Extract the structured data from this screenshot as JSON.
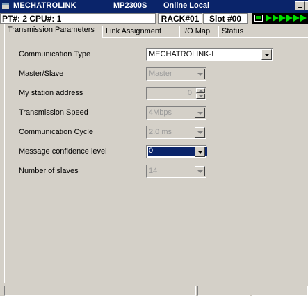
{
  "window": {
    "app_title": "MECHATROLINK",
    "model": "MP2300S",
    "mode": "Online Local"
  },
  "infobar": {
    "pt_cpu": "PT#: 2 CPU#: 1",
    "rack": "RACK#01",
    "slot": "Slot #00"
  },
  "tabs": [
    {
      "label": "Transmission Parameters",
      "active": true
    },
    {
      "label": "Link Assignment",
      "active": false
    },
    {
      "label": "I/O Map",
      "active": false
    },
    {
      "label": "Status",
      "active": false
    }
  ],
  "fields": {
    "communication_type": {
      "label": "Communication Type",
      "value": "MECHATROLINK-I"
    },
    "master_slave": {
      "label": "Master/Slave",
      "value": "Master"
    },
    "my_station_address": {
      "label": "My station address",
      "value": "0"
    },
    "transmission_speed": {
      "label": "Transmission Speed",
      "value": "4Mbps"
    },
    "communication_cycle": {
      "label": "Communication Cycle",
      "value": "2.0 ms"
    },
    "message_confidence_level": {
      "label": "Message confidence level",
      "value": "0"
    },
    "number_of_slaves": {
      "label": "Number of slaves",
      "value": "14"
    }
  },
  "colors": {
    "title_bar": "#0a246a",
    "dialog_face": "#d4d0c8",
    "status_arrows": "#00e000"
  }
}
